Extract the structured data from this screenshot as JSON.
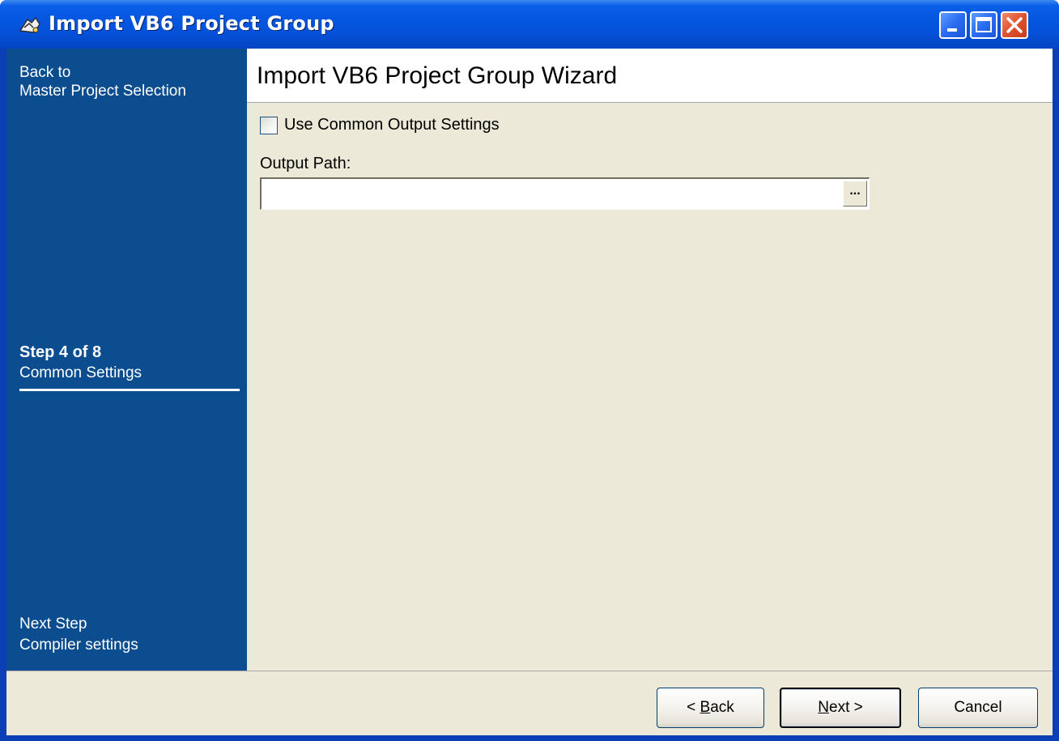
{
  "window": {
    "title": "Import VB6 Project Group",
    "controls": [
      "minimize",
      "maximize",
      "close"
    ]
  },
  "sidebar": {
    "back_line1": "Back to",
    "back_line2": "Master Project Selection",
    "step_title": "Step 4 of 8",
    "step_name": "Common Settings",
    "next_line1": "Next Step",
    "next_line2": "Compiler settings"
  },
  "header": {
    "title": "Import VB6 Project Group Wizard"
  },
  "form": {
    "use_common_label": "Use Common Output Settings",
    "use_common_checked": false,
    "output_path_label": "Output Path:",
    "output_path_value": "",
    "browse_label": "..."
  },
  "footer": {
    "back_prefix": "< ",
    "back_key": "B",
    "back_rest": "ack",
    "next_key": "N",
    "next_rest": "ext >",
    "cancel_label": "Cancel"
  },
  "colors": {
    "sidebar": "#0b4d8f",
    "dialog_face": "#ece9d8",
    "titlebar": "#0556e0"
  }
}
